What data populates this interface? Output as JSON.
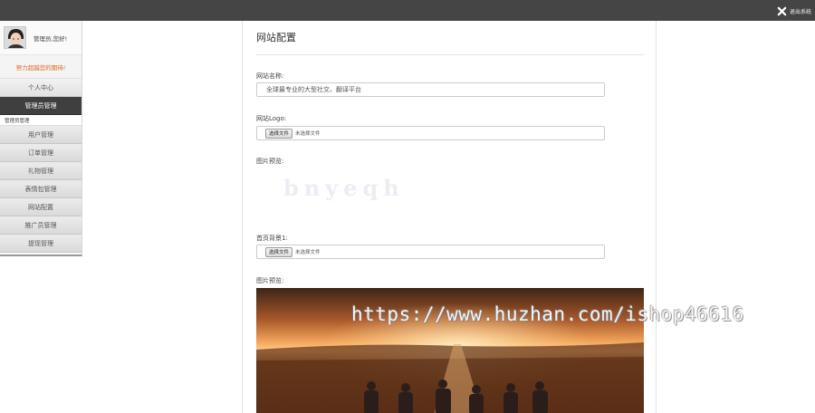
{
  "topbar": {
    "logout_label": "退出系统"
  },
  "sidebar": {
    "greeting": "管理员,您好!",
    "promo": "努力超越您的期待!",
    "personal_center": "个人中心",
    "admin_manage": "管理员管理",
    "sub_title": "管理员管理",
    "items": [
      {
        "label": "用户管理"
      },
      {
        "label": "订单管理"
      },
      {
        "label": "礼物管理"
      },
      {
        "label": "表情包管理"
      },
      {
        "label": "网站配置"
      },
      {
        "label": "推广员管理"
      },
      {
        "label": "提现管理"
      }
    ]
  },
  "main": {
    "title": "网站配置",
    "site_name_label": "网站名称:",
    "site_name_value": "全球最专业的大型社交、翻译平台",
    "logo_label": "网站Logo:",
    "choose_file_label": "选择文件",
    "no_file_label": "未选择文件",
    "preview_label": "图片预览:",
    "logo_placeholder": "bnyeqh",
    "bg1_label": "首页背景1:",
    "preview_label_2": "图片预览:"
  },
  "watermark": "https://www.huzhan.com/ishop46616",
  "colors": {
    "topbar": "#454545",
    "active_nav": "#3f3f3f",
    "promo_text": "#e0641e"
  }
}
